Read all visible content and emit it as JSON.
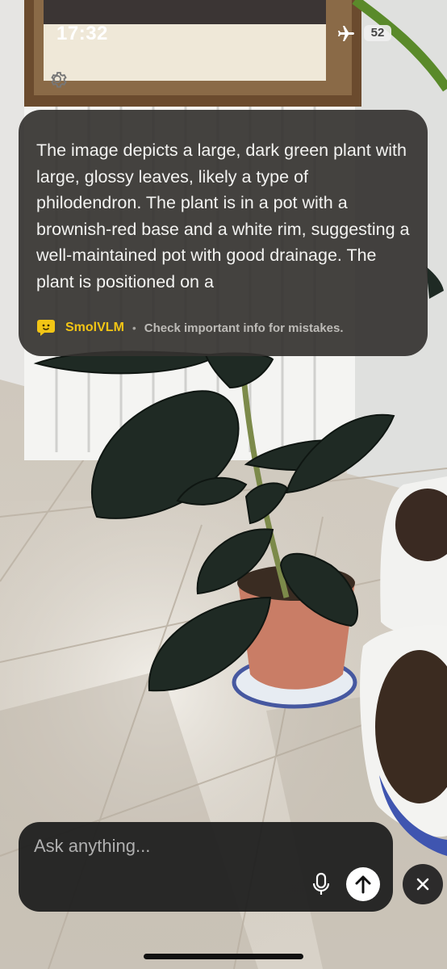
{
  "status_bar": {
    "time": "17:32",
    "battery": "52",
    "airplane_icon": "airplane-icon"
  },
  "settings": {
    "icon": "gear-icon"
  },
  "response": {
    "text": "The image depicts a large, dark green plant with large, glossy leaves, likely a type of philodendron. The plant is in a pot with a brownish-red base and a white rim, suggesting a well-maintained pot with good drainage. The plant is positioned on a",
    "brand_name": "SmolVLM",
    "brand_icon": "smolvlm-face-icon",
    "separator": "•",
    "disclaimer": "Check important info for mistakes."
  },
  "input": {
    "placeholder": "Ask anything...",
    "mic_icon": "microphone-icon",
    "send_icon": "arrow-up-icon",
    "close_icon": "close-icon"
  },
  "colors": {
    "card_bg": "#343230",
    "brand_yellow": "#f2c515",
    "input_bg": "#1e1e1e"
  }
}
